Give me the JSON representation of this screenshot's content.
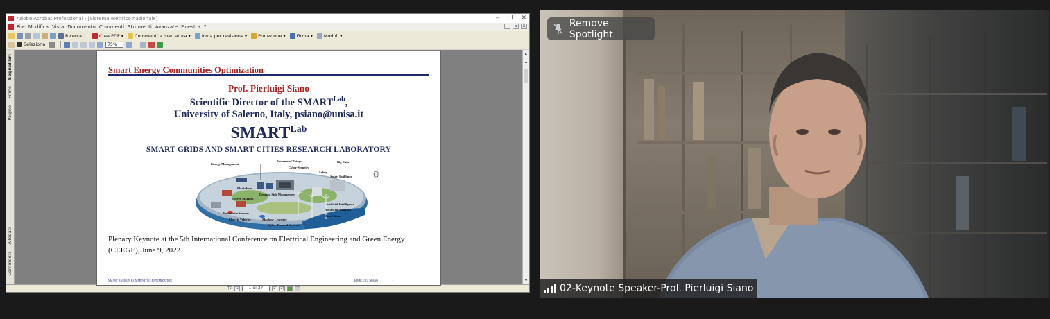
{
  "acrobat": {
    "title": "Adobe Acrobat Professional - [Sistema elettrico nazionale]",
    "menu": [
      "File",
      "Modifica",
      "Vista",
      "Documento",
      "Commenti",
      "Strumenti",
      "Avanzate",
      "Finestra",
      "?"
    ],
    "toolbar1": {
      "search": "Ricerca",
      "create_pdf": "Crea PDF",
      "comments": "Commenti e marcatura",
      "send_review": "Invia per revisione",
      "protection": "Protezione",
      "sign": "Firma",
      "forms": "Moduli"
    },
    "toolbar2": {
      "select": "Seleziona",
      "zoom": "75%"
    },
    "side_tabs": [
      "Segnalibri",
      "Firme",
      "Pagine",
      "Allegati",
      "Commenti"
    ],
    "page_indicator": "1 di 37"
  },
  "pdf": {
    "header": "Smart Energy Communities Optimization",
    "author": "Prof. Pierluigi Siano",
    "director_prefix": "Scientific Director of the SMART",
    "director_sup": "Lab",
    "director_suffix": ",",
    "university": "University of Salerno, Italy, psiano@unisa.it",
    "smart": "SMART",
    "smart_sup": "Lab",
    "lab_name": "SMART GRIDS AND SMART CITIES RESEARCH LABORATORY",
    "figure_labels": [
      "Energy Management",
      "Internet of Things",
      "Cyber-Security",
      "Big Data",
      "Safety",
      "Smart Buildings",
      "Blockchain",
      "Demand Side Management",
      "Energy Markets",
      "Artificial Intelligence",
      "Advanced Analytics",
      "Renewable Sources",
      "Data Science",
      "Electric Vehicles",
      "Machine Learning",
      "Cyber-Physical Systems"
    ],
    "plenary": "Plenary Keynote at the 5th International Conference on Electrical Engineering and Green Energy (CEEGE), June 9, 2022.",
    "footer_left": "Smart energy Communities Optimization",
    "footer_right": "Pierluigi Siano",
    "footer_page": "1"
  },
  "video": {
    "spotlight_button": "Remove Spotlight",
    "participant_name": "02-Keynote Speaker-Prof. Pierluigi Siano",
    "icons": [
      "unpin-icon",
      "signal-bars-icon"
    ]
  }
}
